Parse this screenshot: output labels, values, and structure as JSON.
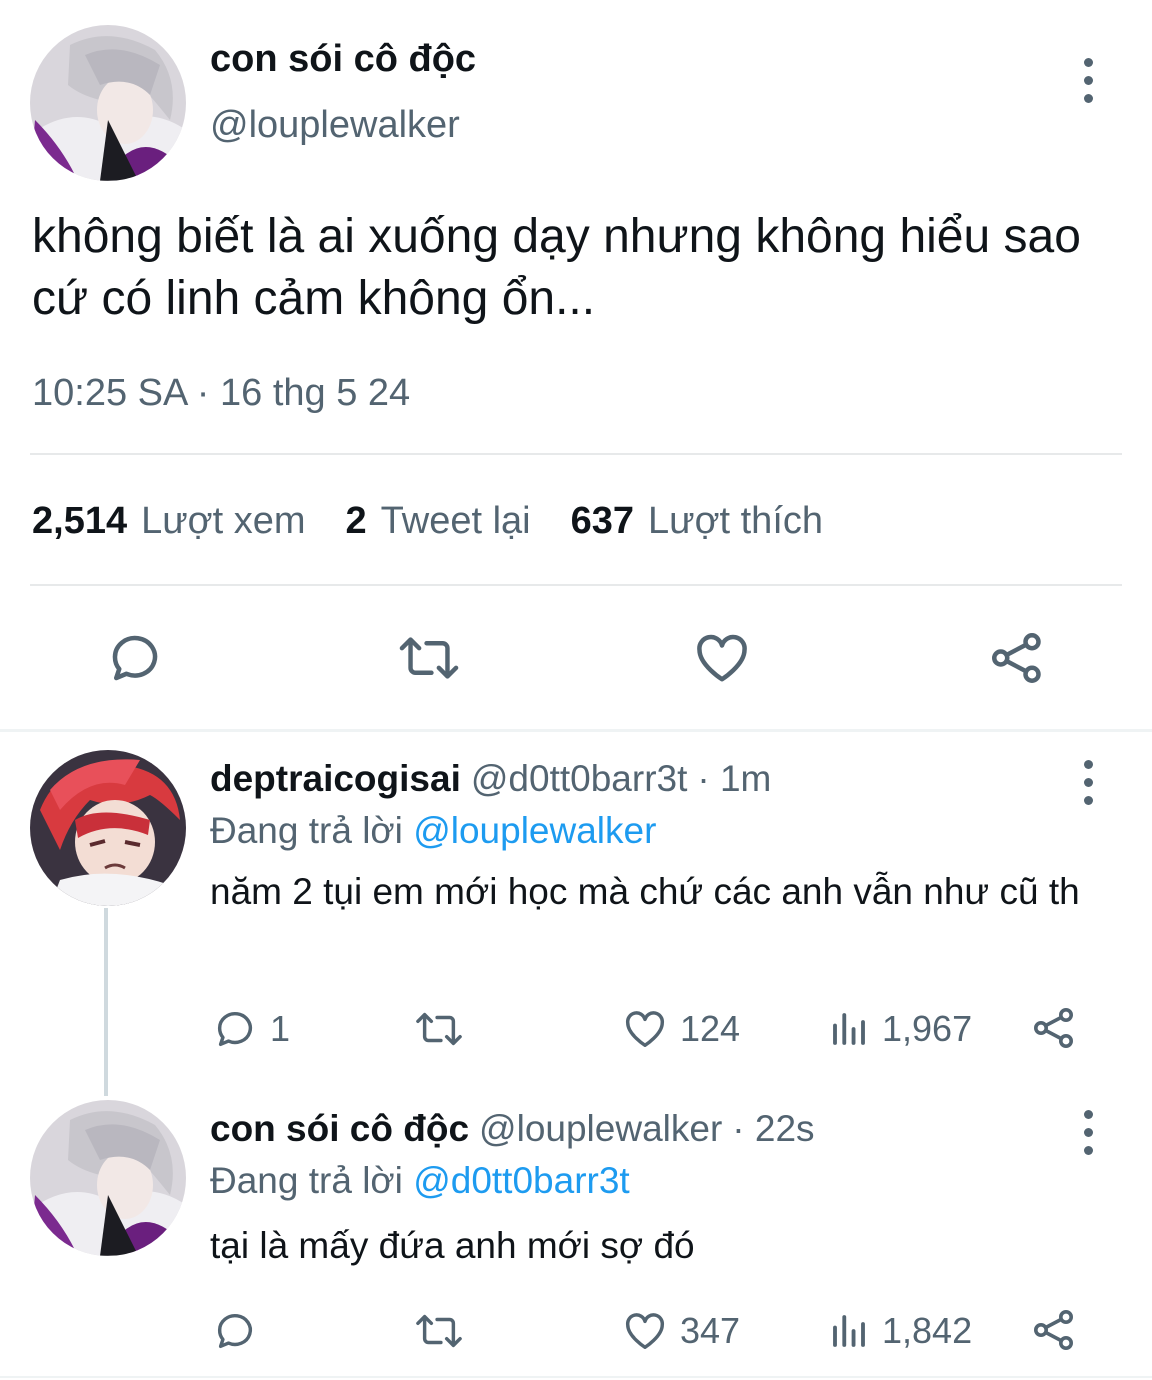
{
  "main_tweet": {
    "display_name": "con sói cô độc",
    "handle": "@louplewalker",
    "text": "không biết là ai xuống dạy nhưng không hiểu sao cứ có linh cảm không ổn...",
    "timestamp": "10:25 SA · 16 thg 5 24",
    "stats": [
      {
        "value": "2,514",
        "label": "Lượt xem"
      },
      {
        "value": "2",
        "label": "Tweet lại"
      },
      {
        "value": "637",
        "label": "Lượt thích"
      }
    ],
    "actions": [
      "reply-icon",
      "retweet-icon",
      "like-icon",
      "share-icon"
    ]
  },
  "replies": [
    {
      "display_name": "deptraicogisai",
      "handle": "@d0tt0barr3t",
      "time": "· 1m",
      "replying_prefix": "Đang trả lời",
      "replying_to": "@louplewalker",
      "text": "năm 2 tụi em mới học mà chứ các anh vẫn như cũ th",
      "reply_count": "1",
      "retweet_count": "",
      "like_count": "124",
      "view_count": "1,967"
    },
    {
      "display_name": "con sói cô độc",
      "handle": "@louplewalker",
      "time": "· 22s",
      "replying_prefix": "Đang trả lời",
      "replying_to": "@d0tt0barr3t",
      "text": "tại là mấy đứa anh mới sợ đó",
      "reply_count": "",
      "retweet_count": "",
      "like_count": "347",
      "view_count": "1,842"
    }
  ],
  "colors": {
    "text_primary": "#0f1419",
    "text_secondary": "#536471",
    "link": "#1d9bf0",
    "divider": "#e7e9ea"
  }
}
